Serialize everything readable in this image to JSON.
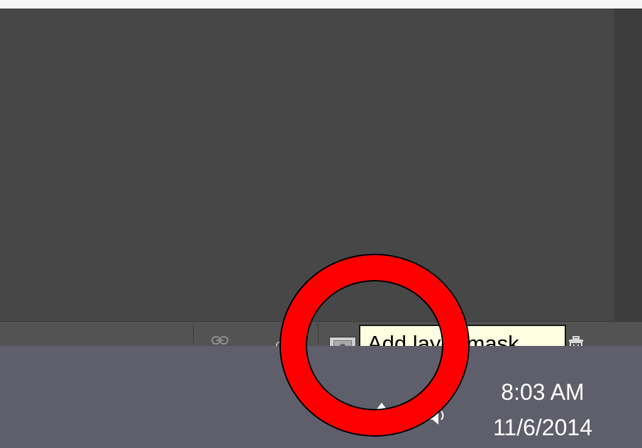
{
  "tooltip": {
    "text": "Add layer mask"
  },
  "clock": {
    "time": "8:03 AM",
    "date": "11/6/2014"
  },
  "panel_footer": {
    "icons": [
      "link-icon",
      "fx-icon",
      "layer-mask-icon",
      "trash-icon"
    ]
  },
  "taskbar": {
    "icons": [
      "tray-up-arrow-icon",
      "volume-icon"
    ]
  },
  "annotation": {
    "shape": "circle",
    "color": "#ff0000"
  },
  "colors": {
    "canvas": "#474747",
    "footer": "#535353",
    "taskbar": "#5f5f6b",
    "tooltip_bg": "#ffffe1"
  }
}
